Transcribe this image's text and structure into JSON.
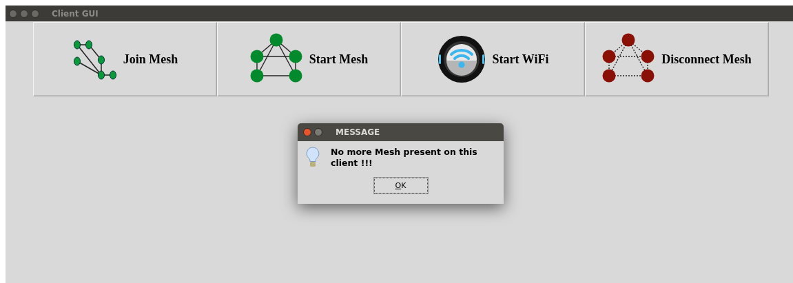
{
  "window": {
    "title": "Client GUI"
  },
  "toolbar": [
    {
      "label": "Join Mesh",
      "kind": "join-mesh"
    },
    {
      "label": "Start Mesh",
      "kind": "start-mesh"
    },
    {
      "label": "Start WiFi",
      "kind": "wifi"
    },
    {
      "label": "Disconnect Mesh",
      "kind": "disconnect-mesh"
    }
  ],
  "dialog": {
    "title": "MESSAGE",
    "message": "No more Mesh present on this client !!!",
    "button": "OK"
  }
}
